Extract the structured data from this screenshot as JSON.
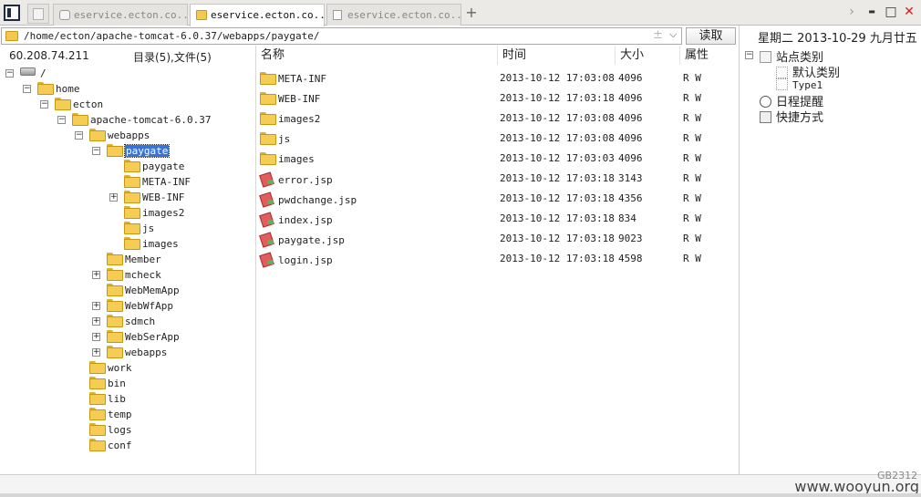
{
  "tabs": [
    {
      "label": "eservice.ecton.co...",
      "icon": "database-icon",
      "active": false
    },
    {
      "label": "eservice.ecton.co...",
      "icon": "folder-icon",
      "active": true
    },
    {
      "label": "eservice.ecton.co...",
      "icon": "document-icon",
      "active": false
    }
  ],
  "window_controls": {
    "forward": "›",
    "minimize": "▬",
    "maximize": "□",
    "close": "✕"
  },
  "address": {
    "path": "/home/ecton/apache-tomcat-6.0.37/webapps/paygate/",
    "star": "±",
    "dropdown": "⌵",
    "read_button": "读取"
  },
  "left": {
    "ip": "60.208.74.211",
    "dir_count": "目录(5),文件(5)",
    "tree": [
      {
        "label": "/",
        "icon": "drive",
        "toggle": "−"
      },
      {
        "label": "home",
        "icon": "folder",
        "toggle": "−"
      },
      {
        "label": "ecton",
        "icon": "folder",
        "toggle": "−"
      },
      {
        "label": "apache-tomcat-6.0.37",
        "icon": "folder",
        "toggle": "−"
      },
      {
        "label": "webapps",
        "icon": "folder",
        "toggle": "−"
      },
      {
        "label": "paygate",
        "icon": "folder",
        "toggle": "−",
        "selected": true
      },
      {
        "label": "paygate",
        "icon": "folder",
        "toggle": ""
      },
      {
        "label": "META-INF",
        "icon": "folder",
        "toggle": ""
      },
      {
        "label": "WEB-INF",
        "icon": "folder",
        "toggle": "+"
      },
      {
        "label": "images2",
        "icon": "folder",
        "toggle": ""
      },
      {
        "label": "js",
        "icon": "folder",
        "toggle": ""
      },
      {
        "label": "images",
        "icon": "folder",
        "toggle": ""
      },
      {
        "label": "Member",
        "icon": "folder",
        "toggle": ""
      },
      {
        "label": "mcheck",
        "icon": "folder",
        "toggle": "+"
      },
      {
        "label": "WebMemApp",
        "icon": "folder",
        "toggle": ""
      },
      {
        "label": "WebWfApp",
        "icon": "folder",
        "toggle": "+"
      },
      {
        "label": "sdmch",
        "icon": "folder",
        "toggle": "+"
      },
      {
        "label": "WebSerApp",
        "icon": "folder",
        "toggle": "+"
      },
      {
        "label": "webapps",
        "icon": "folder",
        "toggle": "+"
      },
      {
        "label": "work",
        "icon": "folder",
        "toggle": ""
      },
      {
        "label": "bin",
        "icon": "folder",
        "toggle": ""
      },
      {
        "label": "lib",
        "icon": "folder",
        "toggle": ""
      },
      {
        "label": "temp",
        "icon": "folder",
        "toggle": ""
      },
      {
        "label": "logs",
        "icon": "folder",
        "toggle": ""
      },
      {
        "label": "conf",
        "icon": "folder",
        "toggle": ""
      }
    ]
  },
  "files": {
    "columns": [
      "名称",
      "时间",
      "大小",
      "属性"
    ],
    "rows": [
      {
        "name": "META-INF",
        "type": "folder",
        "time": "2013-10-12 17:03:08",
        "size": "4096",
        "attr": "R W"
      },
      {
        "name": "WEB-INF",
        "type": "folder",
        "time": "2013-10-12 17:03:18",
        "size": "4096",
        "attr": "R W"
      },
      {
        "name": "images2",
        "type": "folder",
        "time": "2013-10-12 17:03:08",
        "size": "4096",
        "attr": "R W"
      },
      {
        "name": "js",
        "type": "folder",
        "time": "2013-10-12 17:03:08",
        "size": "4096",
        "attr": "R W"
      },
      {
        "name": "images",
        "type": "folder",
        "time": "2013-10-12 17:03:03",
        "size": "4096",
        "attr": "R W"
      },
      {
        "name": "error.jsp",
        "type": "jsp",
        "time": "2013-10-12 17:03:18",
        "size": "3143",
        "attr": "R W"
      },
      {
        "name": "pwdchange.jsp",
        "type": "jsp",
        "time": "2013-10-12 17:03:18",
        "size": "4356",
        "attr": "R W"
      },
      {
        "name": "index.jsp",
        "type": "jsp",
        "time": "2013-10-12 17:03:18",
        "size": "834",
        "attr": "R W"
      },
      {
        "name": "paygate.jsp",
        "type": "jsp",
        "time": "2013-10-12 17:03:18",
        "size": "9023",
        "attr": "R W"
      },
      {
        "name": "login.jsp",
        "type": "jsp",
        "time": "2013-10-12 17:03:18",
        "size": "4598",
        "attr": "R W"
      }
    ]
  },
  "right": {
    "date": "星期二 2013-10-29 九月廿五",
    "site_category": "站点类别",
    "default_category": "默认类别",
    "type1": "Type1",
    "schedule": "日程提醒",
    "shortcuts": "快捷方式"
  },
  "footer": {
    "watermark": "www.wooyun.org",
    "code": "GB2312"
  },
  "colors": {
    "selection": "#3874d8",
    "folder": "#f5cd55",
    "close": "#d42020"
  }
}
